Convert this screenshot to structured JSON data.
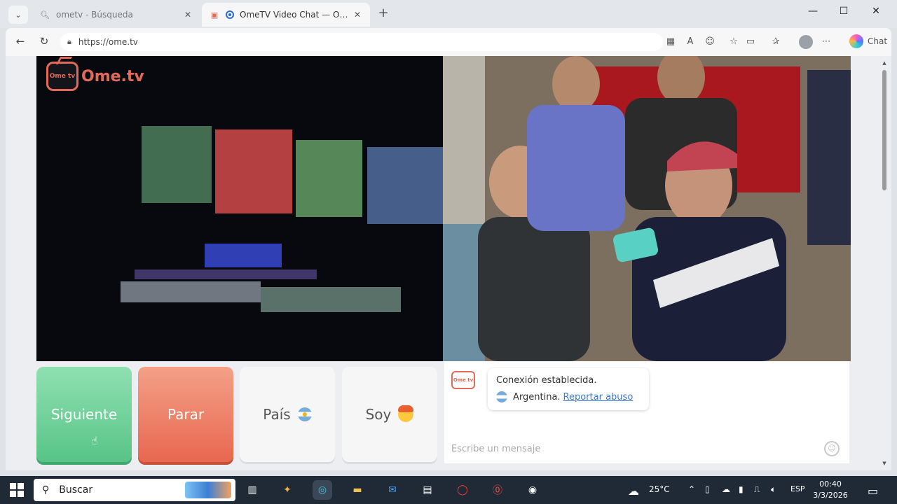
{
  "browser": {
    "tabs": [
      {
        "title": "ometv - Búsqueda",
        "active": false,
        "icon": "search-icon"
      },
      {
        "title": "OmeTV Video Chat — Omegl",
        "active": true,
        "icon": "ometv-favicon"
      }
    ],
    "new_tab_symbol": "+",
    "window_controls": {
      "minimize": "—",
      "maximize": "☐",
      "close": "✕"
    },
    "url": "https://ome.tv",
    "copilot_label": "Chat"
  },
  "page": {
    "logo_text": "Ome.tv",
    "logo_tv_text": "Ome tv",
    "buttons": {
      "next": "Siguiente",
      "stop": "Parar",
      "country": "País",
      "iam": "Soy"
    },
    "chat": {
      "logo_text": "Ome tv",
      "status": "Conexión establecida.",
      "country": "Argentina.",
      "report_link": "Reportar abuso",
      "input_placeholder": "Escribe un mensaje"
    }
  },
  "taskbar": {
    "search_label": "Buscar",
    "weather": "25°C",
    "language": "ESP",
    "time": "00:40",
    "date": "3/3/2026"
  },
  "colors": {
    "next_button": "#58c487",
    "stop_button": "#e8674f",
    "brand": "#e36a5a",
    "link": "#3a7bd5"
  }
}
